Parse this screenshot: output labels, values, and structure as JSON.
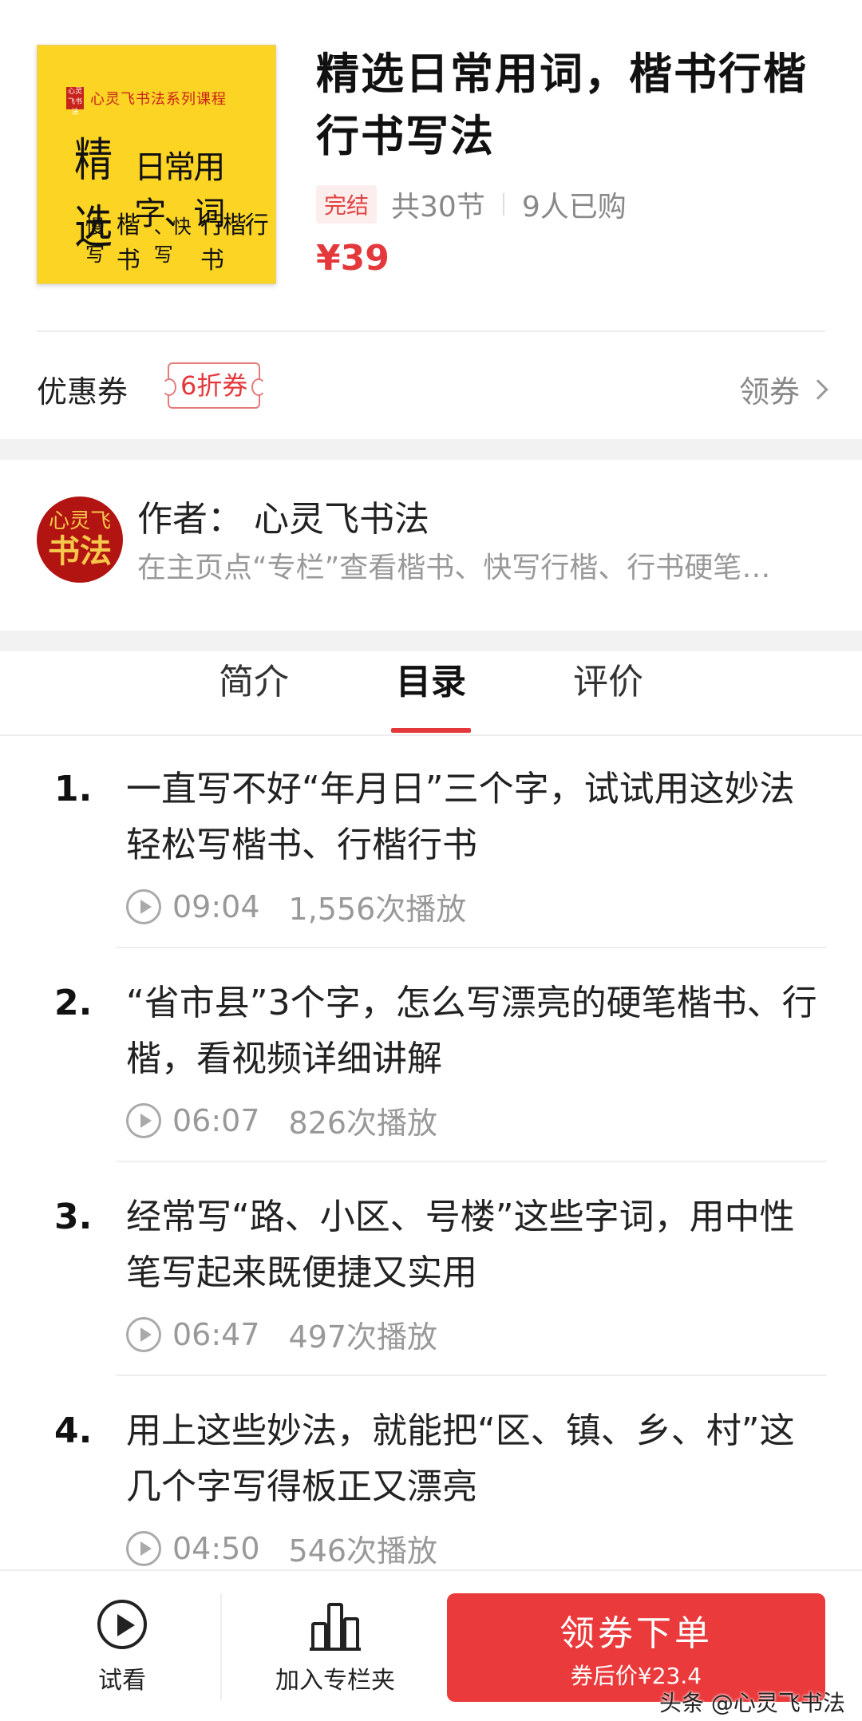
{
  "product": {
    "cover": {
      "series_seal": "心灵飞书法",
      "series": "心灵飞书法系列课程",
      "line1_a": "精选",
      "line1_b": "日常用字、词",
      "line2_a": "慢写",
      "line2_b": "楷书",
      "line2_c": "、快写",
      "line2_d": "行楷行书"
    },
    "title": "精选日常用词，楷书行楷行书写法",
    "status": "完结",
    "lessons_count": "共30节",
    "buyers": "9人已购",
    "price": "¥39"
  },
  "coupon": {
    "label": "优惠券",
    "tag": "6折券",
    "action": "领券"
  },
  "author": {
    "avatar_top": "心灵飞",
    "avatar_bottom": "书法",
    "name": "作者：  心灵飞书法",
    "description": "在主页点“专栏”查看楷书、快写行楷、行书硬笔书法课程"
  },
  "tabs": [
    "简介",
    "目录",
    "评价"
  ],
  "active_tab": "目录",
  "lessons": [
    {
      "num": "1.",
      "title": "一直写不好“年月日”三个字，试试用这妙法轻松写楷书、行楷行书",
      "duration": "09:04",
      "plays": "1,556次播放"
    },
    {
      "num": "2.",
      "title": "“省市县”3个字，怎么写漂亮的硬笔楷书、行楷，看视频详细讲解",
      "duration": "06:07",
      "plays": "826次播放"
    },
    {
      "num": "3.",
      "title": "经常写“路、小区、号楼”这些字词，用中性笔写起来既便捷又实用",
      "duration": "06:47",
      "plays": "497次播放"
    },
    {
      "num": "4.",
      "title": "用上这些妙法，就能把“区、镇、乡、村”这几个字写得板正又漂亮",
      "duration": "04:50",
      "plays": "546次播放"
    }
  ],
  "bottom_bar": {
    "trial": "试看",
    "add_to_folder": "加入专栏夹",
    "buy_main": "领券下单",
    "buy_sub": "券后价¥23.4"
  },
  "watermark": "头条 @心灵飞书法",
  "colors": {
    "accent": "#e4393c",
    "cover_bg": "#fcd424",
    "avatar_bg": "#b21412"
  },
  "icons": [
    "play-circle-icon",
    "chevron-right-icon",
    "trial-play-icon",
    "bar-chart-folder-icon"
  ]
}
